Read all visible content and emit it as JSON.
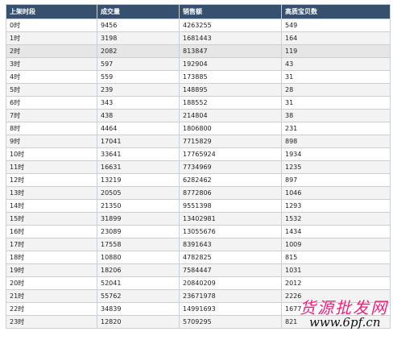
{
  "table": {
    "headers": [
      "上架时段",
      "成交量",
      "销售额",
      "高质宝贝数"
    ],
    "rows": [
      [
        "0时",
        "9456",
        "4263255",
        "549"
      ],
      [
        "1时",
        "3198",
        "1681443",
        "164"
      ],
      [
        "2时",
        "2082",
        "813847",
        "119"
      ],
      [
        "3时",
        "597",
        "192904",
        "43"
      ],
      [
        "4时",
        "559",
        "173885",
        "31"
      ],
      [
        "5时",
        "239",
        "148895",
        "28"
      ],
      [
        "6时",
        "343",
        "188552",
        "31"
      ],
      [
        "7时",
        "438",
        "214804",
        "38"
      ],
      [
        "8时",
        "4464",
        "1806800",
        "231"
      ],
      [
        "9时",
        "17041",
        "7715829",
        "898"
      ],
      [
        "10时",
        "33641",
        "17765924",
        "1934"
      ],
      [
        "11时",
        "16631",
        "7734969",
        "1235"
      ],
      [
        "12时",
        "13219",
        "6282462",
        "897"
      ],
      [
        "13时",
        "20505",
        "8772806",
        "1046"
      ],
      [
        "14时",
        "21350",
        "9551398",
        "1293"
      ],
      [
        "15时",
        "31899",
        "13402981",
        "1532"
      ],
      [
        "16时",
        "23089",
        "13055676",
        "1434"
      ],
      [
        "17时",
        "17558",
        "8391643",
        "1009"
      ],
      [
        "18时",
        "10880",
        "4782825",
        "815"
      ],
      [
        "19时",
        "18206",
        "7584447",
        "1031"
      ],
      [
        "20时",
        "52041",
        "20840209",
        "2012"
      ],
      [
        "21时",
        "55762",
        "23671978",
        "2226"
      ],
      [
        "22时",
        "34839",
        "14991693",
        "1677"
      ],
      [
        "23时",
        "12820",
        "5709295",
        "821"
      ]
    ],
    "highlighted_row": 2
  },
  "watermark": {
    "chinese": "货源批发网",
    "url": "www.6pf.cn"
  },
  "colors": {
    "header_bg": "#36506e",
    "header_text": "#ffffff",
    "row_alt_bg": "#f3f3f3",
    "row_highlight_bg": "#e6e6e6",
    "border": "#c9cfd6",
    "watermark_pink": "#ff1a7a"
  }
}
